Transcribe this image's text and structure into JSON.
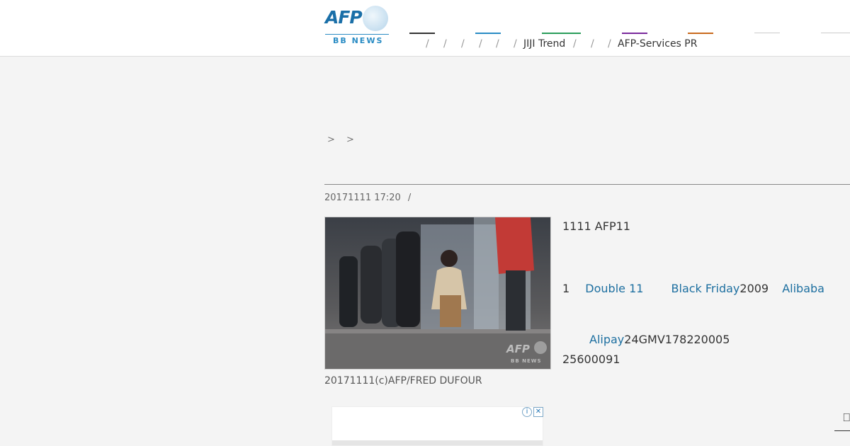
{
  "header": {
    "logo": {
      "brand": "AFP",
      "sub": "BB NEWS"
    },
    "nav_colors": [
      "#333333",
      "#2a8cc4",
      "#2a9d5a",
      "#7a2a9c",
      "#c96a1e",
      "#cccccc",
      "#cccccc"
    ],
    "separators": [
      "/",
      "/",
      "/",
      "/",
      "/",
      "/",
      "/",
      "/"
    ],
    "links": [
      {
        "label": "JIJI Trend"
      },
      {
        "label": "AFP-Services PR"
      }
    ]
  },
  "breadcrumb": "> >",
  "article": {
    "title": "",
    "date": "20171111 17:20",
    "date_sep": "/",
    "caption": "20171111(c)AFP/FRED DUFOUR",
    "para1": "1111 AFP11",
    "para2": {
      "lead": "1",
      "link1": "Double 11",
      "link2": "Black Friday",
      "text2": "2009",
      "link3": "Alibaba"
    },
    "para3": {
      "link": "Alipay",
      "text": "24GMV178220005",
      "line2": "25600091"
    }
  },
  "photo": {
    "watermark_brand": "AFP",
    "watermark_sub": "BB NEWS"
  },
  "ad": {
    "info_icon": "i",
    "close_icon": "✕"
  },
  "corner_glyph": "⎕"
}
